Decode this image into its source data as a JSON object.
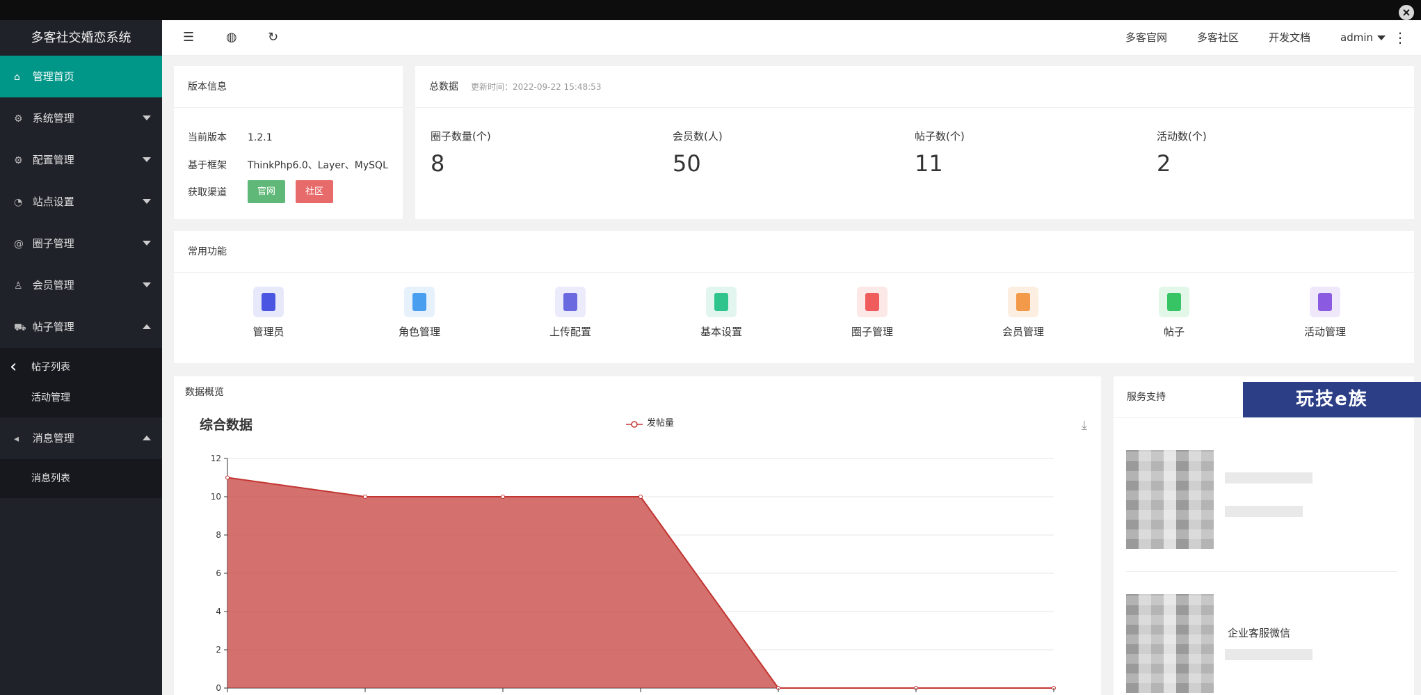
{
  "app": {
    "title": "多客社交婚恋系统"
  },
  "sidebar": {
    "items": [
      {
        "label": "管理首页",
        "icon": "home-icon",
        "active": true
      },
      {
        "label": "系统管理",
        "icon": "gear-icon"
      },
      {
        "label": "配置管理",
        "icon": "gear-icon"
      },
      {
        "label": "站点设置",
        "icon": "palette-icon"
      },
      {
        "label": "圈子管理",
        "icon": "at-icon"
      },
      {
        "label": "会员管理",
        "icon": "user-icon"
      },
      {
        "label": "帖子管理",
        "icon": "cart-icon",
        "expanded": true
      },
      {
        "label": "消息管理",
        "icon": "speaker-icon",
        "expanded": true
      }
    ],
    "post_sub": [
      "帖子列表",
      "活动管理"
    ],
    "msg_sub": [
      "消息列表"
    ]
  },
  "header": {
    "links": [
      "多客官网",
      "多客社区",
      "开发文档"
    ],
    "user": "admin"
  },
  "version_card": {
    "title": "版本信息",
    "rows": [
      {
        "label": "当前版本",
        "value": "1.2.1"
      },
      {
        "label": "基于框架",
        "value": "ThinkPhp6.0、Layer、MySQL"
      },
      {
        "label": "获取渠道",
        "value": ""
      }
    ],
    "btn_official": "官网",
    "btn_community": "社区"
  },
  "totals_card": {
    "title": "总数据",
    "updated": "更新时间：2022-09-22 15:48:53",
    "stats": [
      {
        "label": "圈子数量(个)",
        "value": "8"
      },
      {
        "label": "会员数(人)",
        "value": "50"
      },
      {
        "label": "帖子数(个)",
        "value": "11"
      },
      {
        "label": "活动数(个)",
        "value": "2"
      }
    ]
  },
  "functions_card": {
    "title": "常用功能",
    "items": [
      {
        "label": "管理员",
        "bg": "#e7e9fb",
        "fg": "#4a56e2"
      },
      {
        "label": "角色管理",
        "bg": "#e6f1fc",
        "fg": "#4a9ef0"
      },
      {
        "label": "上传配置",
        "bg": "#ecebfb",
        "fg": "#6b69e0"
      },
      {
        "label": "基本设置",
        "bg": "#e2f6ef",
        "fg": "#2ec48c"
      },
      {
        "label": "圈子管理",
        "bg": "#fde8e8",
        "fg": "#f05b5b"
      },
      {
        "label": "会员管理",
        "bg": "#fdeee2",
        "fg": "#f39a4a"
      },
      {
        "label": "帖子",
        "bg": "#e3f7e9",
        "fg": "#37c465"
      },
      {
        "label": "活动管理",
        "bg": "#efe8fb",
        "fg": "#8a5ae0"
      }
    ]
  },
  "overview_card": {
    "title": "数据概览",
    "chart_title": "综合数据",
    "legend": "发帖量"
  },
  "support_card": {
    "title": "服务支持",
    "wechat": "企业客服微信"
  },
  "brand": {
    "text": "玩技e族"
  },
  "chart_data": {
    "type": "area",
    "series": [
      {
        "name": "发帖量",
        "values": [
          11,
          10,
          10,
          10,
          0,
          0,
          0
        ],
        "color": "#c23531"
      }
    ],
    "ylim": [
      0,
      12
    ],
    "yticks": [
      0,
      2,
      4,
      6,
      8,
      10,
      12
    ],
    "grid": true,
    "legend_position": "top"
  }
}
